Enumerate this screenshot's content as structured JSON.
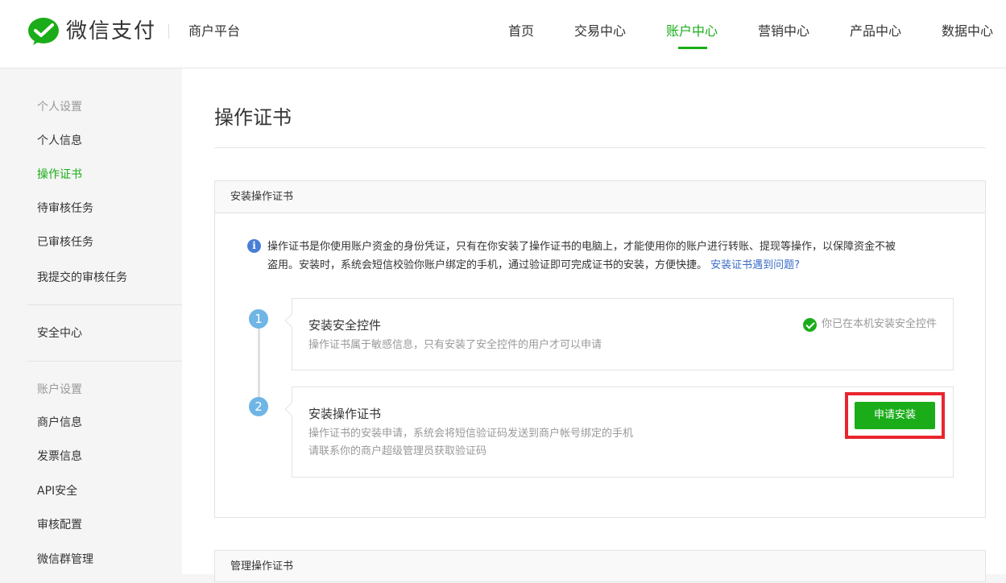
{
  "header": {
    "brand": "微信支付",
    "platform": "商户平台",
    "nav": [
      {
        "label": "首页"
      },
      {
        "label": "交易中心"
      },
      {
        "label": "账户中心"
      },
      {
        "label": "营销中心"
      },
      {
        "label": "产品中心"
      },
      {
        "label": "数据中心"
      }
    ],
    "active_nav": "账户中心"
  },
  "sidebar": {
    "group1": "个人设置",
    "items1": [
      {
        "label": "个人信息"
      },
      {
        "label": "操作证书"
      },
      {
        "label": "待审核任务"
      },
      {
        "label": "已审核任务"
      },
      {
        "label": "我提交的审核任务"
      }
    ],
    "security": "安全中心",
    "group2": "账户设置",
    "items2": [
      {
        "label": "商户信息"
      },
      {
        "label": "发票信息"
      },
      {
        "label": "API安全"
      },
      {
        "label": "审核配置"
      },
      {
        "label": "微信群管理"
      }
    ],
    "active_item": "操作证书"
  },
  "main": {
    "title": "操作证书",
    "panel_title": "安装操作证书",
    "info_icon": "i",
    "info_line1": "操作证书是你使用账户资金的身份凭证，只有在你安装了操作证书的电脑上，才能使用你的账户进行转账、提现等操作，以保障资金不被",
    "info_line2": "盗用。安装时，系统会短信校验你账户绑定的手机，通过验证即可完成证书的安装，方便快捷。",
    "info_link": "安装证书遇到问题?",
    "steps": [
      {
        "num": "1",
        "title": "安装安全控件",
        "desc": "操作证书属于敏感信息，只有安装了安全控件的用户才可以申请",
        "status": "你已在本机安装安全控件"
      },
      {
        "num": "2",
        "title": "安装操作证书",
        "desc1": "操作证书的安装申请，系统会将短信验证码发送到商户帐号绑定的手机",
        "desc2": "请联系你的商户超级管理员获取验证码",
        "button": "申请安装"
      }
    ],
    "panel2_title": "管理操作证书"
  },
  "colors": {
    "brand_green": "#1aad19",
    "step_blue": "#6fb5e6",
    "link_blue": "#3a6cc6",
    "highlight_red": "#e8252f"
  }
}
